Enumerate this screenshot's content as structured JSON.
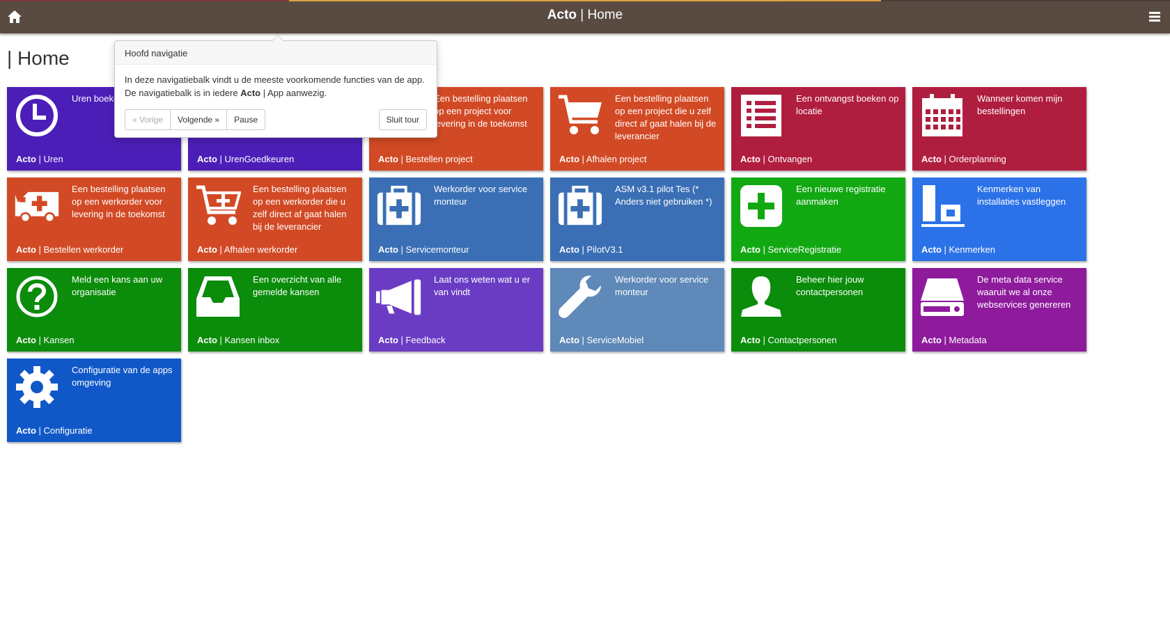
{
  "header": {
    "brand": "Acto",
    "separator": " | ",
    "title": "Home",
    "bg_color": "#594b42",
    "home_icon": "home-icon",
    "menu_icon": "hamburger-menu-icon"
  },
  "page": {
    "title": "| Home"
  },
  "tour": {
    "title": "Hoofd navigatie",
    "line1": "In deze navigatiebalk vindt u de meeste voorkomende functies van de app.",
    "line2_prefix": "De navigatiebalk is in iedere ",
    "line2_brand": "Acto",
    "line2_suffix": " | App aanwezig.",
    "prev_label": "« Vorige",
    "next_label": "Volgende »",
    "pause_label": "Pause",
    "end_label": "Sluit tour"
  },
  "tiles": [
    {
      "desc": "Uren boeken",
      "brand": "Acto",
      "name": " | Uren",
      "color": "#4c1eb8",
      "icon": "clock-icon"
    },
    {
      "desc": "",
      "brand": "Acto",
      "name": " | UrenGoedkeuren",
      "color": "#4c1eb8",
      "icon": "check-icon"
    },
    {
      "desc": "Een bestelling plaatsen op een project voor levering in de toekomst",
      "brand": "Acto",
      "name": " | Bestellen project",
      "color": "#d24a25",
      "icon": "truck-icon"
    },
    {
      "desc": "Een bestelling plaatsen op een project die u zelf direct af gaat halen bij de leverancier",
      "brand": "Acto",
      "name": " | Afhalen project",
      "color": "#d24a25",
      "icon": "shopping-cart-icon"
    },
    {
      "desc": "Een ontvangst boeken op locatie",
      "brand": "Acto",
      "name": " | Ontvangen",
      "color": "#b01e3f",
      "icon": "list-icon"
    },
    {
      "desc": "Wanneer komen mijn bestellingen",
      "brand": "Acto",
      "name": " | Orderplanning",
      "color": "#b01e3f",
      "icon": "calendar-icon"
    },
    {
      "desc": "Een bestelling plaatsen op een werkorder voor levering in de toekomst",
      "brand": "Acto",
      "name": " | Bestellen werkorder",
      "color": "#d24a25",
      "icon": "ambulance-icon"
    },
    {
      "desc": "Een bestelling plaatsen op een werkorder die u zelf direct af gaat halen bij de leverancier",
      "brand": "Acto",
      "name": " | Afhalen werkorder",
      "color": "#d24a25",
      "icon": "cart-plus-icon"
    },
    {
      "desc": "Werkorder voor service monteur",
      "brand": "Acto",
      "name": " | Servicemonteur",
      "color": "#3a6fb5",
      "icon": "medkit-icon"
    },
    {
      "desc": "ASM v3.1 pilot Tes (* Anders niet gebruiken *)",
      "brand": "Acto",
      "name": " | PilotV3.1",
      "color": "#3a6fb5",
      "icon": "medkit-icon"
    },
    {
      "desc": "Een nieuwe registratie aanmaken",
      "brand": "Acto",
      "name": " | ServiceRegistratie",
      "color": "#12a812",
      "icon": "plus-square-icon"
    },
    {
      "desc": "Kenmerken van installaties vastleggen",
      "brand": "Acto",
      "name": " | Kenmerken",
      "color": "#2b72e8",
      "icon": "installation-icon"
    },
    {
      "desc": "Meld een kans aan uw organisatie",
      "brand": "Acto",
      "name": " | Kansen",
      "color": "#0b8c0b",
      "icon": "question-circle-icon"
    },
    {
      "desc": "Een overzicht van alle gemelde kansen",
      "brand": "Acto",
      "name": " | Kansen inbox",
      "color": "#0b8c0b",
      "icon": "inbox-icon"
    },
    {
      "desc": "Laat ons weten wat u er van vindt",
      "brand": "Acto",
      "name": " | Feedback",
      "color": "#6a3cc4",
      "icon": "megaphone-icon"
    },
    {
      "desc": "Werkorder voor service monteur",
      "brand": "Acto",
      "name": " | ServiceMobiel",
      "color": "#5e89b8",
      "icon": "wrench-icon"
    },
    {
      "desc": "Beheer hier jouw contactpersonen",
      "brand": "Acto",
      "name": " | Contactpersonen",
      "color": "#0b8c0b",
      "icon": "user-icon"
    },
    {
      "desc": "De meta data service waaruit we al onze webservices genereren",
      "brand": "Acto",
      "name": " | Metadata",
      "color": "#8e1b9c",
      "icon": "hard-drive-icon"
    },
    {
      "desc": "Configuratie van de apps omgeving",
      "brand": "Acto",
      "name": " | Configuratie",
      "color": "#1058c8",
      "icon": "gear-icon"
    }
  ]
}
